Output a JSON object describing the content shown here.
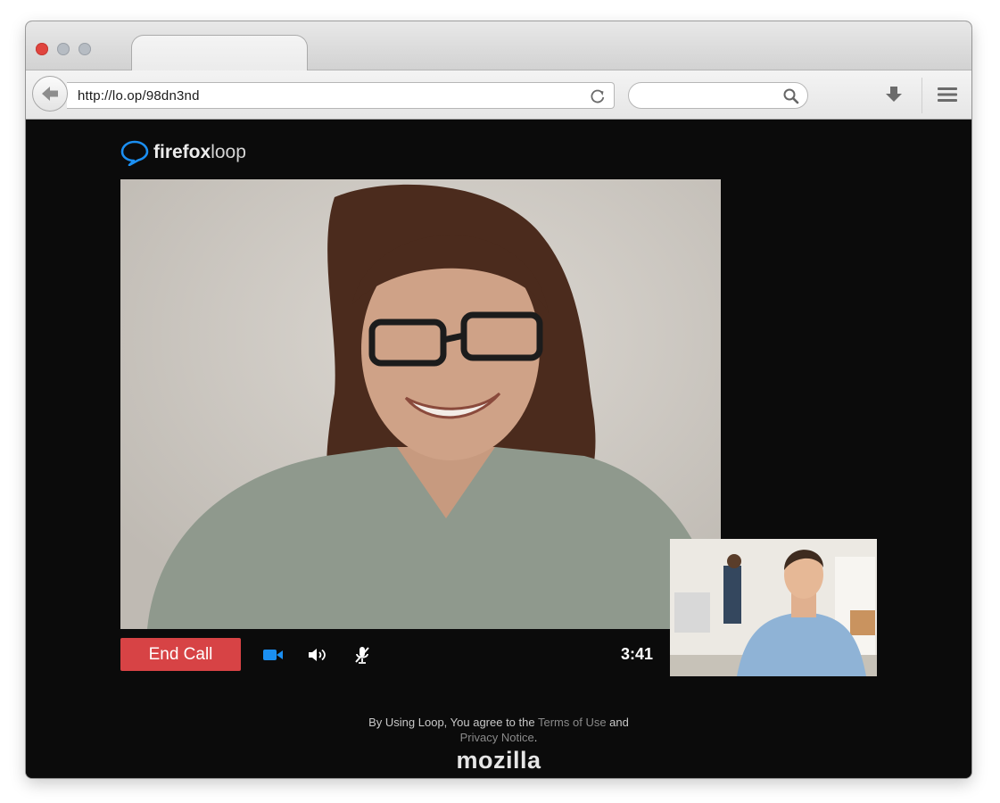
{
  "browser": {
    "url": "http://lo.op/98dn3nd",
    "search_placeholder": ""
  },
  "logo": {
    "bold": "firefox",
    "light": "loop",
    "icon": "speech-bubble-icon"
  },
  "call": {
    "end_call_label": "End Call",
    "timer": "3:41",
    "icons": [
      "video-camera-icon",
      "speaker-icon",
      "muted-microphone-icon"
    ]
  },
  "footer": {
    "text_before": "By Using Loop, You agree to the ",
    "terms_link": "Terms of Use",
    "text_and": " and",
    "privacy_link": "Privacy Notice",
    "period": ".",
    "brand": "mozilla"
  },
  "colors": {
    "end_call": "#d74345",
    "accent_blue": "#1b8ff2",
    "page_bg": "#0b0b0b"
  }
}
